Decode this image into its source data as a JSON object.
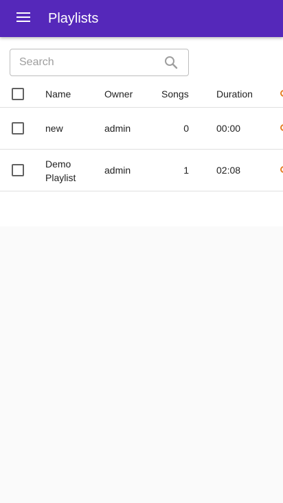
{
  "appbar": {
    "title": "Playlists",
    "menu_icon": "menu-icon",
    "color": "#5528ba"
  },
  "search": {
    "placeholder": "Search",
    "value": "",
    "icon": "search-icon"
  },
  "table": {
    "columns": [
      "Name",
      "Owner",
      "Songs",
      "Duration"
    ],
    "rows": [
      {
        "name": "new",
        "owner": "admin",
        "songs": "0",
        "duration": "00:00"
      },
      {
        "name": "Demo Playlist",
        "owner": "admin",
        "songs": "1",
        "duration": "02:08"
      }
    ]
  }
}
